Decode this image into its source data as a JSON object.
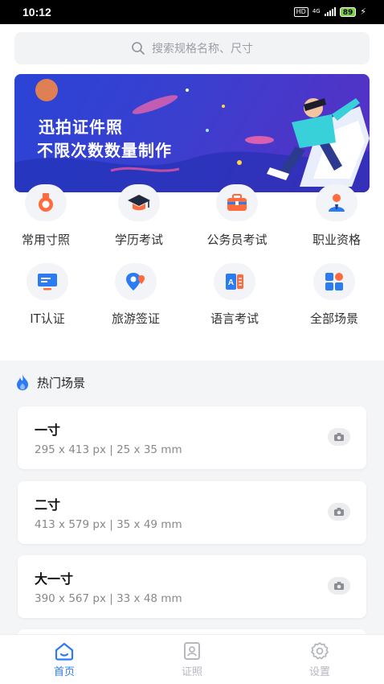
{
  "status_bar": {
    "time": "10:12",
    "hd": "HD",
    "network": "4G",
    "battery": "89"
  },
  "search": {
    "placeholder": "搜索规格名称、尺寸"
  },
  "banner": {
    "line1": "迅拍证件照",
    "line2": "不限次数数量制作"
  },
  "categories": [
    {
      "label": "常用寸照",
      "icon": "medal-icon"
    },
    {
      "label": "学历考试",
      "icon": "graduation-cap-icon"
    },
    {
      "label": "公务员考试",
      "icon": "briefcase-icon"
    },
    {
      "label": "职业资格",
      "icon": "user-badge-icon"
    },
    {
      "label": "IT认证",
      "icon": "monitor-icon"
    },
    {
      "label": "旅游签证",
      "icon": "map-pin-icon"
    },
    {
      "label": "语言考试",
      "icon": "language-book-icon"
    },
    {
      "label": "全部场景",
      "icon": "grid-apps-icon"
    }
  ],
  "hot_section": {
    "title": "热门场景",
    "icon": "flame-icon"
  },
  "specs": [
    {
      "name": "一寸",
      "size": "295 x 413 px | 25 x 35 mm"
    },
    {
      "name": "二寸",
      "size": "413 x 579 px | 35 x 49 mm"
    },
    {
      "name": "大一寸",
      "size": "390 x 567 px | 33 x 48 mm"
    }
  ],
  "tabs": [
    {
      "label": "首页",
      "icon": "home-icon",
      "active": true
    },
    {
      "label": "证照",
      "icon": "id-photo-icon",
      "active": false
    },
    {
      "label": "设置",
      "icon": "gear-icon",
      "active": false
    }
  ],
  "colors": {
    "accent": "#2b7bf3",
    "orange": "#ff6b3d",
    "banner_blue": "#2a44d6"
  }
}
